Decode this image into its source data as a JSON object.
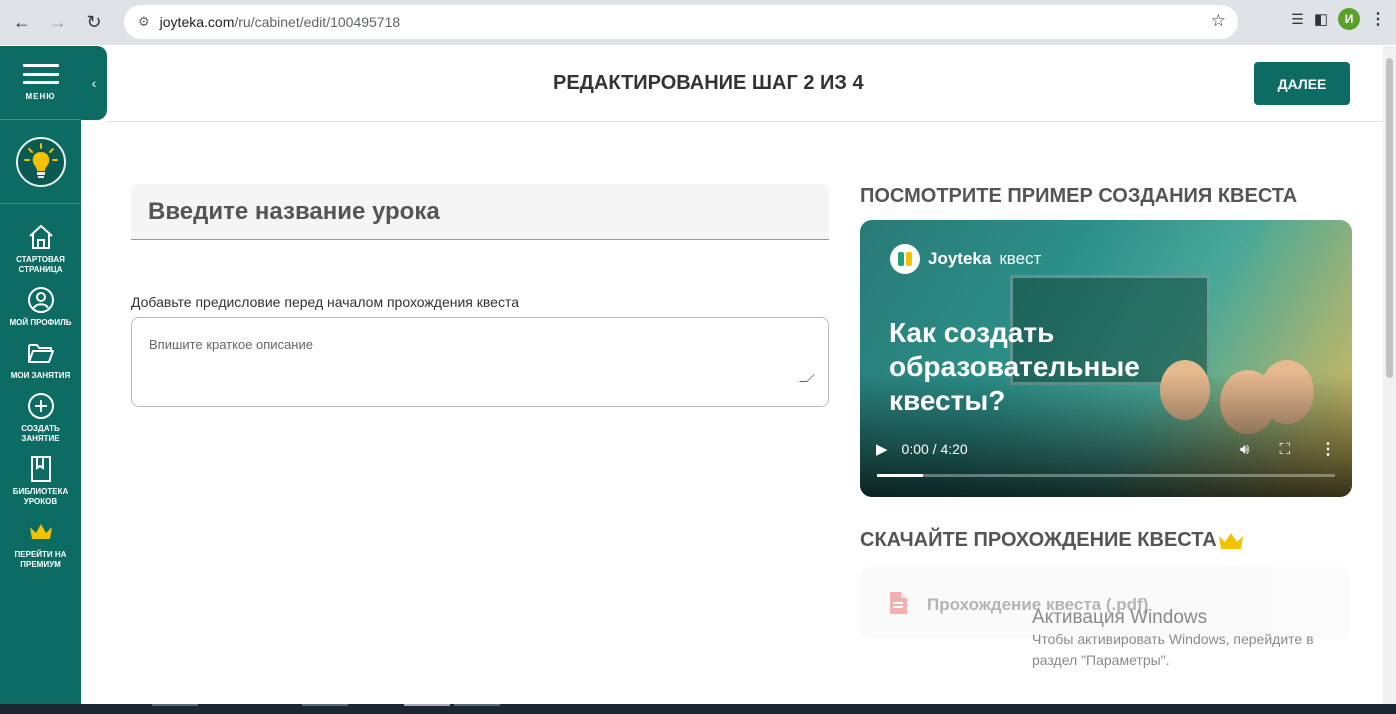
{
  "browser": {
    "url_host": "joyteka.com",
    "url_path": "/ru/cabinet/edit/100495718",
    "profile_initial": "И"
  },
  "sidebar": {
    "menu_label": "МЕНЮ",
    "items": [
      {
        "label": "СТАРТОВАЯ СТРАНИЦА",
        "icon": "home-icon"
      },
      {
        "label": "МОЙ ПРОФИЛЬ",
        "icon": "profile-icon"
      },
      {
        "label": "МОИ ЗАНЯТИЯ",
        "icon": "folder-icon"
      },
      {
        "label": "СОЗДАТЬ ЗАНЯТИЕ",
        "icon": "plus-circle-icon"
      },
      {
        "label": "БИБЛИОТЕКА УРОКОВ",
        "icon": "book-icon"
      },
      {
        "label": "ПЕРЕЙТИ НА ПРЕМИУМ",
        "icon": "crown-icon"
      }
    ]
  },
  "header": {
    "title": "РЕДАКТИРОВАНИЕ ШАГ 2 ИЗ 4",
    "next_label": "ДАЛЕЕ"
  },
  "form": {
    "title_placeholder": "Введите название урока",
    "preface_label": "Добавьте предисловие перед началом прохождения квеста",
    "description_placeholder": "Впишите краткое описание"
  },
  "example": {
    "section_title": "ПОСМОТРИТЕ ПРИМЕР СОЗДАНИЯ КВЕСТА",
    "video": {
      "brand": "Joyteka",
      "brand_sub": "квест",
      "headline": "Как создать образовательные квесты?",
      "time": "0:00 / 4:20",
      "progress": 0.1
    }
  },
  "download": {
    "section_title": "СКАЧАЙТЕ ПРОХОЖДЕНИЕ КВЕСТА",
    "pdf_label": "Прохождение квеста (.pdf)"
  },
  "watermark": {
    "title": "Активация Windows",
    "line1": "Чтобы активировать Windows, перейдите в",
    "line2": "раздел \"Параметры\"."
  },
  "colors": {
    "brand": "#0c6b63",
    "crown": "#f2c200"
  }
}
